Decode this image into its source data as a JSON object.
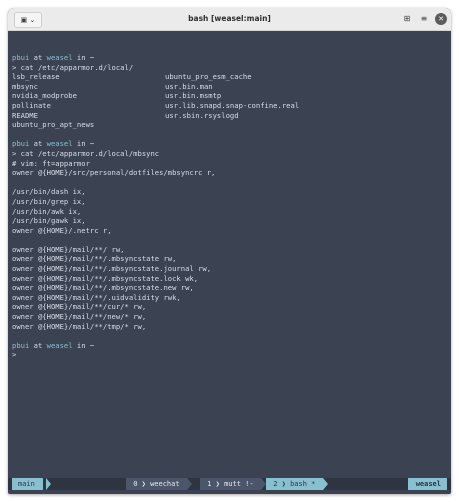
{
  "window": {
    "title": "bash [weasel:main]"
  },
  "titlebar": {
    "left_icon": "terminal-icon",
    "dropdown_icon": "chevron-down-icon",
    "grid_icon": "grid-icon",
    "menu_icon": "hamburger-icon",
    "close_icon": "close-icon"
  },
  "terminal": {
    "prompt": {
      "user": "pbui",
      "at": "at",
      "host": "weasel",
      "in": "in ~",
      "symbol": ">"
    },
    "blocks": [
      {
        "command": "cat /etc/apparmor.d/local/",
        "listing": [
          [
            "lsb_release",
            "ubuntu_pro_esm_cache"
          ],
          [
            "mbsync",
            "usr.bin.man"
          ],
          [
            "nvidia_modprobe",
            "usr.bin.msmtp"
          ],
          [
            "pollinate",
            "usr.lib.snapd.snap-confine.real"
          ],
          [
            "README",
            "usr.sbin.rsyslogd"
          ],
          [
            "ubuntu_pro_apt_news",
            ""
          ]
        ]
      },
      {
        "command": "cat /etc/apparmor.d/local/mbsync",
        "lines": [
          "# vim: ft=apparmor",
          "owner @{HOME}/src/personal/dotfiles/mbsyncrc r,",
          "",
          "/usr/bin/dash ix,",
          "/usr/bin/grep ix,",
          "/usr/bin/awk ix,",
          "/usr/bin/gawk ix,",
          "owner @{HOME}/.netrc r,",
          "",
          "owner @{HOME}/mail/**/ rw,",
          "owner @{HOME}/mail/**/.mbsyncstate rw,",
          "owner @{HOME}/mail/**/.mbsyncstate.journal rw,",
          "owner @{HOME}/mail/**/.mbsyncstate.lock wk,",
          "owner @{HOME}/mail/**/.mbsyncstate.new rw,",
          "owner @{HOME}/mail/**/.uidvalidity rwk,",
          "owner @{HOME}/mail/**/cur/* rw,",
          "owner @{HOME}/mail/**/new/* rw,",
          "owner @{HOME}/mail/**/tmp/* rw,"
        ]
      }
    ]
  },
  "statusbar": {
    "session": "main",
    "windows": [
      {
        "index": "0",
        "name": "weechat",
        "flag": ""
      },
      {
        "index": "1",
        "name": "mutt",
        "flag": "!-"
      },
      {
        "index": "2",
        "name": "bash",
        "flag": "*"
      }
    ],
    "host": "weasel"
  },
  "colors": {
    "background": "#3b4252",
    "foreground": "#d8dee9",
    "accent": "#88c0d0",
    "status_bg": "#2e3440",
    "status_dim": "#4c566a"
  }
}
